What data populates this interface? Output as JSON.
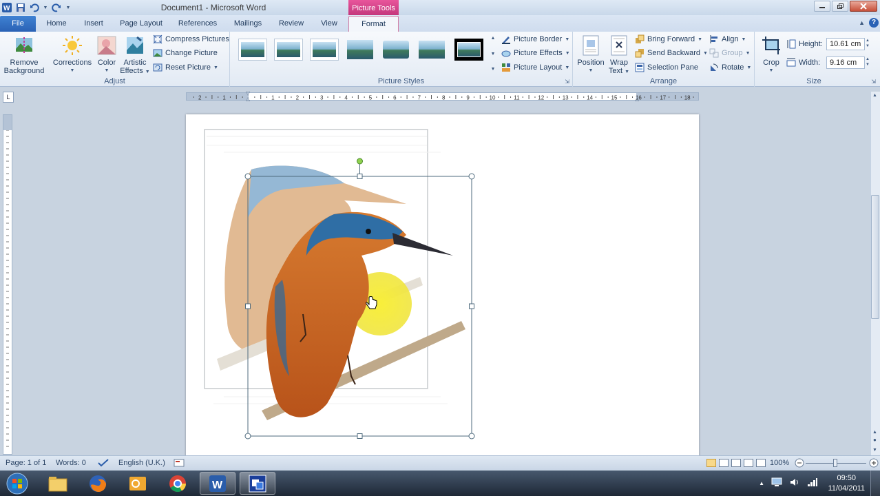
{
  "window": {
    "doc_title": "Document1 - Microsoft Word",
    "context_tab": "Picture Tools"
  },
  "tabs": {
    "file": "File",
    "items": [
      "Home",
      "Insert",
      "Page Layout",
      "References",
      "Mailings",
      "Review",
      "View",
      "Format"
    ],
    "active": "Format"
  },
  "ribbon": {
    "adjust": {
      "label": "Adjust",
      "remove_background": "Remove Background",
      "remove_background_l1": "Remove",
      "remove_background_l2": "Background",
      "corrections": "Corrections",
      "color": "Color",
      "artistic_l1": "Artistic",
      "artistic_l2": "Effects",
      "compress": "Compress Pictures",
      "change": "Change Picture",
      "reset": "Reset Picture"
    },
    "styles": {
      "label": "Picture Styles",
      "border": "Picture Border",
      "effects": "Picture Effects",
      "layout": "Picture Layout"
    },
    "arrange": {
      "label": "Arrange",
      "position": "Position",
      "wrap_l1": "Wrap",
      "wrap_l2": "Text",
      "bring_forward": "Bring Forward",
      "send_backward": "Send Backward",
      "selection_pane": "Selection Pane",
      "align": "Align",
      "group": "Group",
      "rotate": "Rotate"
    },
    "size": {
      "label": "Size",
      "crop": "Crop",
      "height_label": "Height:",
      "height_value": "10.61 cm",
      "width_label": "Width:",
      "width_value": "9.16 cm"
    }
  },
  "ruler": {
    "labels": [
      "2",
      "1",
      "1",
      "2",
      "3",
      "4",
      "5",
      "6",
      "7",
      "8",
      "9",
      "10",
      "11",
      "12",
      "13",
      "14",
      "15",
      "16",
      "17",
      "18"
    ]
  },
  "statusbar": {
    "page": "Page: 1 of 1",
    "words": "Words: 0",
    "language": "English (U.K.)",
    "zoom": "100%"
  },
  "taskbar": {
    "time": "09:50",
    "date": "11/04/2011"
  },
  "colors": {
    "file_tab": "#2a62b5",
    "context_tab": "#c2367b",
    "ribbon_bg": "#e2eaf4",
    "selection_handle": "#4d6a7d"
  }
}
